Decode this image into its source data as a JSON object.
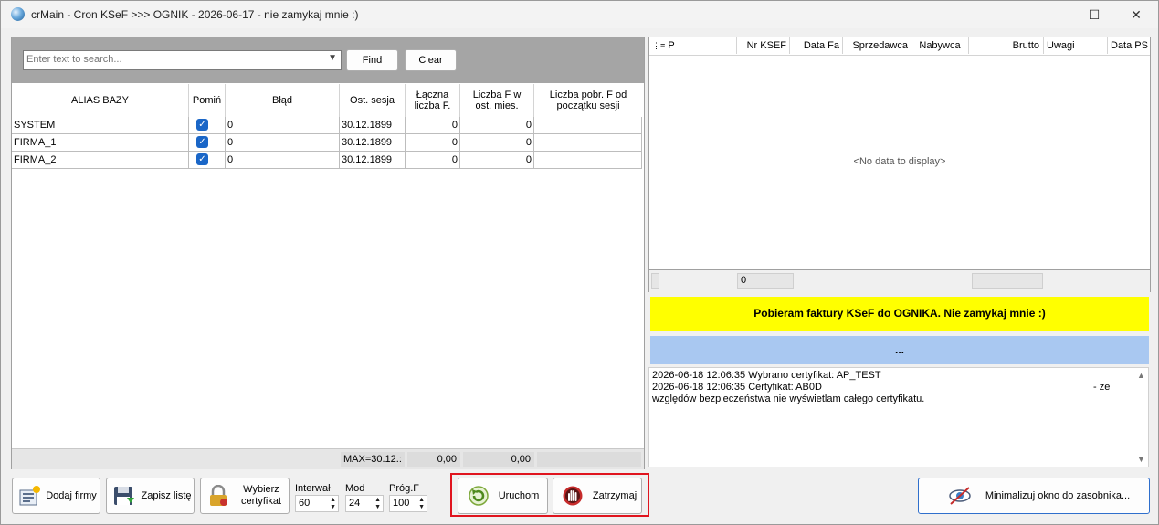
{
  "window": {
    "title": "crMain - Cron KSeF >>> OGNIK - 2026-06-17 - nie zamykaj mnie :)",
    "controls": {
      "minimize": "—",
      "maximize": "☐",
      "close": "✕"
    }
  },
  "search": {
    "placeholder": "Enter text to search...",
    "find_label": "Find",
    "clear_label": "Clear"
  },
  "left_grid": {
    "columns": [
      "ALIAS BAZY",
      "Pomiń",
      "Błąd",
      "Ost. sesja",
      "Łączna liczba F.",
      "Liczba F w ost. mies.",
      "Liczba pobr. F od początku sesji"
    ],
    "rows": [
      {
        "alias": "SYSTEM",
        "pomin": true,
        "blad": "0",
        "ost_sesja": "30.12.1899",
        "laczna": "0",
        "liczba_mies": "0",
        "liczba_pobr": ""
      },
      {
        "alias": "FIRMA_1",
        "pomin": true,
        "blad": "0",
        "ost_sesja": "30.12.1899",
        "laczna": "0",
        "liczba_mies": "0",
        "liczba_pobr": ""
      },
      {
        "alias": "FIRMA_2",
        "pomin": true,
        "blad": "0",
        "ost_sesja": "30.12.1899",
        "laczna": "0",
        "liczba_mies": "0",
        "liczba_pobr": ""
      }
    ],
    "footer": {
      "max": "MAX=30.12.:",
      "sum1": "0,00",
      "sum2": "0,00"
    }
  },
  "right_grid": {
    "columns": [
      "P",
      "Nr KSEF",
      "Data Fa",
      "Sprzedawca",
      "Nabywca",
      "Brutto",
      "Uwagi",
      "Data PS"
    ],
    "empty_text": "<No data to display>",
    "footer_count": "0"
  },
  "status": {
    "yellow": "Pobieram faktury KSeF do OGNIKA. Nie zamykaj mnie :)",
    "blue": "..."
  },
  "log": [
    "2026-06-18 12:06:35 Wybrano certyfikat: AP_TEST",
    "2026-06-18 12:06:35 Certyfikat: AB0D",
    "- ze",
    "względów bezpieczeństwa nie wyświetlam całego certyfikatu."
  ],
  "toolbar": {
    "add_company": "Dodaj firmy",
    "save_list": "Zapisz listę",
    "choose_cert": "Wybierz certyfikat",
    "interval_label": "Interwał",
    "interval_value": "60",
    "mod_label": "Mod",
    "mod_value": "24",
    "prog_label": "Próg.F",
    "prog_value": "100",
    "run": "Uruchom",
    "stop": "Zatrzymaj",
    "minimize_tray": "Minimalizuj okno do zasobnika..."
  },
  "colors": {
    "status_yellow": "#ffff00",
    "status_blue": "#a9c8f1",
    "highlight_frame": "#e0141e",
    "checkbox": "#1a66c7"
  }
}
